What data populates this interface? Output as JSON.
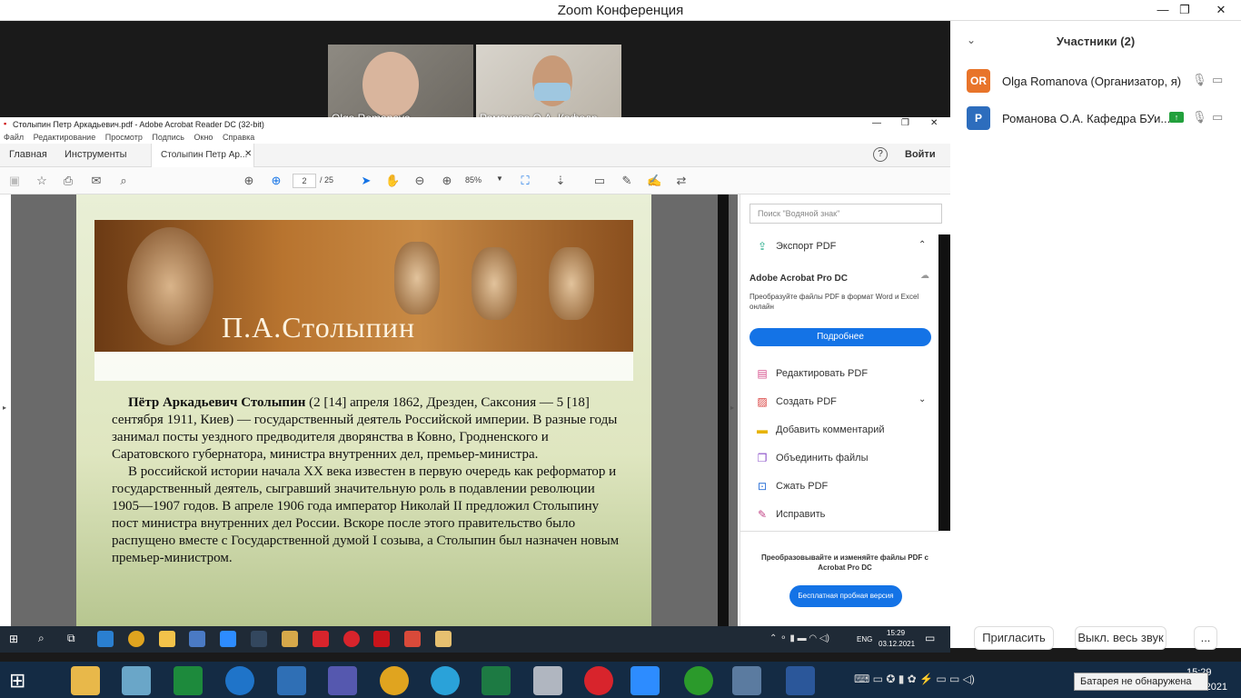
{
  "zoom": {
    "window_title": "Zoom Конференция",
    "participants_title": "Участники (2)",
    "videos": [
      {
        "name": "Olga Romanova"
      },
      {
        "name": "Романова О.А. Кафедр..."
      }
    ],
    "participants": [
      {
        "initials": "OR",
        "name": "Olga Romanova (Организатор, я)",
        "color": "#e8742a"
      },
      {
        "initials": "Р",
        "name": "Романова О.А. Кафедра БУи...",
        "color": "#2d6dbd"
      }
    ],
    "buttons": {
      "invite": "Пригласить",
      "mute_all": "Выкл. весь звук",
      "more": "..."
    }
  },
  "acrobat": {
    "window_title": "Столыпин Петр Аркадьевич.pdf - Adobe Acrobat Reader DC (32-bit)",
    "menu": [
      "Файл",
      "Редактирование",
      "Просмотр",
      "Подпись",
      "Окно",
      "Справка"
    ],
    "tabs": {
      "home": "Главная",
      "tools": "Инструменты",
      "doc": "Столыпин Петр Ар..."
    },
    "help": "?",
    "login": "Войти",
    "page_current": "2",
    "page_total": "/ 25",
    "zoom": "85%",
    "search_placeholder": "Поиск \"Водяной знак\"",
    "export_pdf": "Экспорт PDF",
    "promo_title": "Adobe Acrobat Pro DC",
    "promo_text": "Преобразуйте файлы PDF в формат Word и Excel онлайн",
    "promo_button": "Подробнее",
    "tools": [
      "Редактировать PDF",
      "Создать PDF",
      "Добавить комментарий",
      "Объединить файлы",
      "Сжать PDF",
      "Исправить"
    ],
    "bottom_text": "Преобразовывайте и изменяйте файлы PDF с Acrobat Pro DC",
    "trial_button": "Бесплатная пробная версия"
  },
  "document": {
    "banner_title": "П.А.Столыпин",
    "para1_bold": "Пётр Аркадьевич Столыпин",
    "para1_rest": " (2 [14] апреля 1862, Дрезден, Саксония — 5 [18] сентября 1911, Киев) — государственный деятель Российской империи. В разные годы занимал посты уездного предводителя дворянства в Ковно, Гродненского и Саратовского губернатора, министра внутренних дел, премьер-министра.",
    "para2": "В российской истории начала XX века известен в первую очередь как реформатор и государственный деятель, сыгравший значительную роль в подавлении революции 1905—1907 годов. В апреле 1906 года император Николай II предложил Столыпину пост министра внутренних дел России. Вскоре после этого правительство было распущено вместе с Государственной думой I созыва, а Столыпин был назначен новым премьер-министром."
  },
  "inner_taskbar": {
    "lang": "ENG",
    "time": "15:29",
    "date": "03.12.2021"
  },
  "taskbar": {
    "time": "15:29",
    "date": "03.12.2021",
    "tooltip": "Батарея не обнаружена"
  }
}
